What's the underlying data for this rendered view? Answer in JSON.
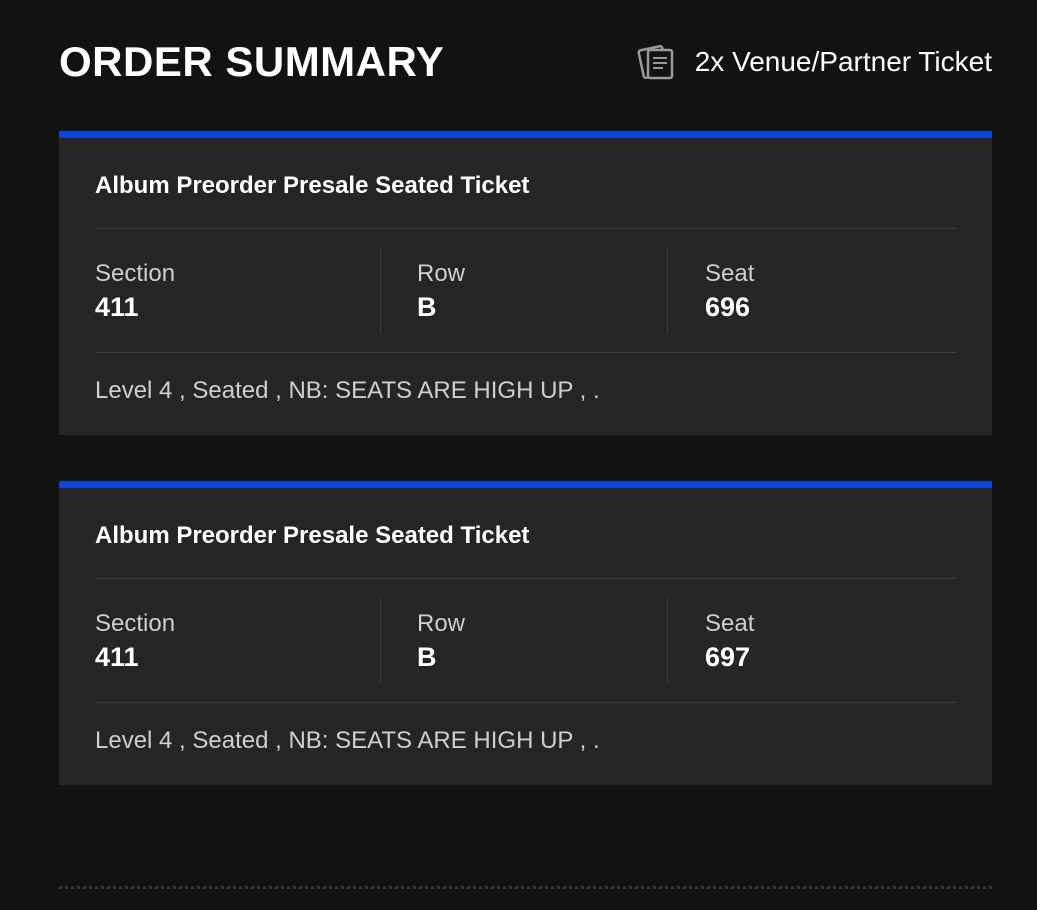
{
  "header": {
    "title": "ORDER SUMMARY",
    "ticket_icon": "ticket-icon",
    "ticket_count_label": "2x Venue/Partner Ticket"
  },
  "colors": {
    "background": "#121212",
    "card_background": "#252525",
    "card_accent": "#0a47d6",
    "label_text": "#cfcfcf",
    "value_text": "#ffffff"
  },
  "tickets": [
    {
      "name": "Album Preorder Presale Seated Ticket",
      "section_label": "Section",
      "section": "411",
      "row_label": "Row",
      "row": "B",
      "seat_label": "Seat",
      "seat": "696",
      "notes": "Level 4 , Seated , NB: SEATS ARE HIGH UP , ."
    },
    {
      "name": "Album Preorder Presale Seated Ticket",
      "section_label": "Section",
      "section": "411",
      "row_label": "Row",
      "row": "B",
      "seat_label": "Seat",
      "seat": "697",
      "notes": "Level 4 , Seated , NB: SEATS ARE HIGH UP , ."
    }
  ]
}
